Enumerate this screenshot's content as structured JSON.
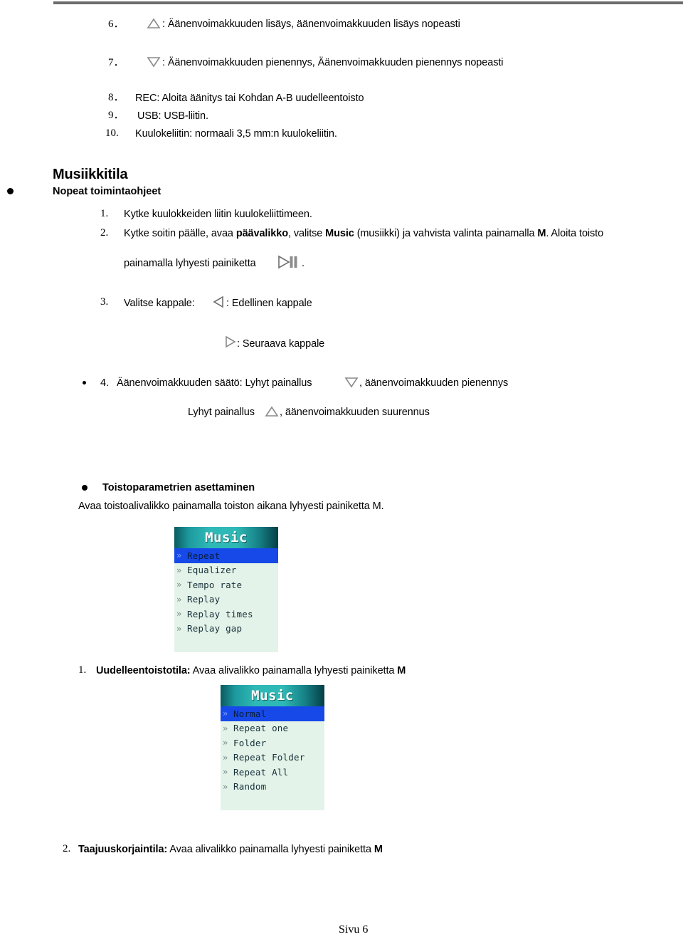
{
  "page": {
    "footer_label": "Sivu 6",
    "accent_selected": "#1649e8",
    "accent_header_teal": "#2fb9b6",
    "screen_background": "#e4f3e9"
  },
  "key_list": [
    {
      "number": "6．",
      "icon": "triangle-up-icon",
      "text": ": Äänenvoimakkuuden lisäys, äänenvoimakkuuden lisäys nopeasti"
    },
    {
      "number": "7．",
      "icon": "triangle-down-icon",
      "text": ": Äänenvoimakkuuden pienennys, Äänenvoimakkuuden pienennys nopeasti"
    },
    {
      "number": "8．",
      "icon": "",
      "text": "REC: Aloita äänitys tai Kohdan A-B uudelleentoisto"
    },
    {
      "number": "9．",
      "icon": "",
      "text": "USB: USB-liitin."
    },
    {
      "number": "10.",
      "icon": "",
      "text": "Kuulokeliitin: normaali 3,5 mm:n kuulokeliitin."
    }
  ],
  "music_mode": {
    "heading": "Musiikkitila",
    "subheading": "Nopeat toimintaohjeet",
    "steps": [
      {
        "number": "1.",
        "text": "Kytke kuulokkeiden liitin kuulokeliittimeen."
      },
      {
        "number": "2.",
        "text_a": "Kytke soitin päälle, avaa ",
        "bold_a": "päävalikko",
        "text_b": ", valitse ",
        "bold_b": "Music",
        "text_c": " (musiikki) ja vahvista valinta painamalla ",
        "bold_c": "M",
        "text_d": ". Aloita toisto",
        "line2_a": "painamalla lyhyesti painiketta",
        "line2_icon": "play-pause-icon",
        "line2_b": "."
      },
      {
        "number": "3.",
        "text_a": "Valitse kappale:",
        "icon_prev": "triangle-left-icon",
        "text_b": ": Edellinen kappale",
        "icon_next": "triangle-right-icon",
        "text_c": ": Seuraava kappale"
      },
      {
        "number": "4.",
        "text_a": "Äänenvoimakkuuden säätö: Lyhyt painallus",
        "icon_down": "triangle-down-icon",
        "text_b": ", äänenvoimakkuuden pienennys",
        "line2_a": "Lyhyt painallus",
        "icon_up": "triangle-up-icon",
        "line2_b": ", äänenvoimakkuuden suurennus"
      }
    ]
  },
  "playback_params": {
    "heading": "Toistoparametrien asettaminen",
    "description": "Avaa toistoalivalikko painamalla toiston aikana lyhyesti painiketta M.",
    "menu_music": {
      "title": "Music",
      "items": [
        {
          "label": "Repeat",
          "selected": true
        },
        {
          "label": "Equalizer",
          "selected": false
        },
        {
          "label": "Tempo rate",
          "selected": false
        },
        {
          "label": "Replay",
          "selected": false
        },
        {
          "label": "Replay times",
          "selected": false
        },
        {
          "label": "Replay gap",
          "selected": false
        }
      ]
    },
    "item1": {
      "number": "1.",
      "bold": "Uudelleentoistotila:",
      "text": " Avaa alivalikko painamalla lyhyesti painiketta ",
      "bold_end": "M"
    },
    "menu_repeat": {
      "title": "Music",
      "items": [
        {
          "label": "Normal",
          "selected": true
        },
        {
          "label": "Repeat one",
          "selected": false
        },
        {
          "label": "Folder",
          "selected": false
        },
        {
          "label": "Repeat Folder",
          "selected": false
        },
        {
          "label": "Repeat All",
          "selected": false
        },
        {
          "label": "Random",
          "selected": false
        }
      ]
    },
    "item2": {
      "number": "2.",
      "bold": "Taajuuskorjaintila:",
      "text": " Avaa alivalikko painamalla lyhyesti painiketta ",
      "bold_end": "M"
    }
  }
}
